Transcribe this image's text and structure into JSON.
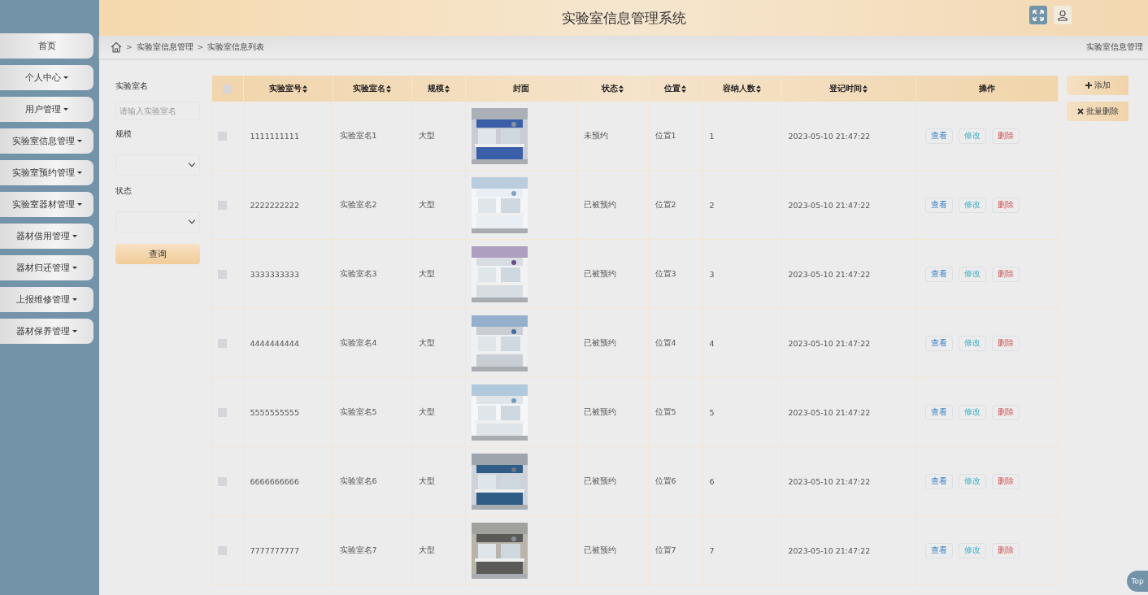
{
  "header": {
    "title": "实验室信息管理系统"
  },
  "sidebar": {
    "items": [
      {
        "label": "首页",
        "dropdown": false
      },
      {
        "label": "个人中心",
        "dropdown": true
      },
      {
        "label": "用户管理",
        "dropdown": true
      },
      {
        "label": "实验室信息管理",
        "dropdown": true
      },
      {
        "label": "实验室预约管理",
        "dropdown": true
      },
      {
        "label": "实验室器材管理",
        "dropdown": true
      },
      {
        "label": "器材借用管理",
        "dropdown": true
      },
      {
        "label": "器材归还管理",
        "dropdown": true
      },
      {
        "label": "上报维修管理",
        "dropdown": true
      },
      {
        "label": "器材保养管理",
        "dropdown": true
      }
    ]
  },
  "breadcrumb": {
    "separator": ">",
    "items": [
      "实验室信息管理",
      "实验室信息列表"
    ],
    "page_title": "实验室信息管理"
  },
  "filters": {
    "name_label": "实验室名",
    "name_placeholder": "请输入实验室名",
    "scale_label": "规模",
    "status_label": "状态",
    "query_button": "查询"
  },
  "actions": {
    "add": "添加",
    "batch_delete": "批量删除"
  },
  "table": {
    "select_all_checked": false,
    "columns": [
      {
        "label": "实验室号",
        "sortable": true
      },
      {
        "label": "实验室名",
        "sortable": true
      },
      {
        "label": "规模",
        "sortable": true
      },
      {
        "label": "封面",
        "sortable": false
      },
      {
        "label": "状态",
        "sortable": true
      },
      {
        "label": "位置",
        "sortable": true
      },
      {
        "label": "容纳人数",
        "sortable": true
      },
      {
        "label": "登记时间",
        "sortable": true
      },
      {
        "label": "操作",
        "sortable": false
      }
    ],
    "rows": [
      {
        "checked": false,
        "number": "1111111111",
        "name": "实验室名1",
        "scale": "大型",
        "status": "未预约",
        "location": "位置1",
        "capacity": "1",
        "time": "2023-05-10 21:47:22",
        "buttons": [
          "查看",
          "修改",
          "删除"
        ]
      },
      {
        "checked": false,
        "number": "2222222222",
        "name": "实验室名2",
        "scale": "大型",
        "status": "已被预约",
        "location": "位置2",
        "capacity": "2",
        "time": "2023-05-10 21:47:22",
        "buttons": [
          "查看",
          "修改",
          "删除"
        ]
      },
      {
        "checked": false,
        "number": "3333333333",
        "name": "实验室名3",
        "scale": "大型",
        "status": "已被预约",
        "location": "位置3",
        "capacity": "3",
        "time": "2023-05-10 21:47:22",
        "buttons": [
          "查看",
          "修改",
          "删除"
        ]
      },
      {
        "checked": false,
        "number": "4444444444",
        "name": "实验室名4",
        "scale": "大型",
        "status": "已被预约",
        "location": "位置4",
        "capacity": "4",
        "time": "2023-05-10 21:47:22",
        "buttons": [
          "查看",
          "修改",
          "删除"
        ]
      },
      {
        "checked": false,
        "number": "5555555555",
        "name": "实验室名5",
        "scale": "大型",
        "status": "已被预约",
        "location": "位置5",
        "capacity": "5",
        "time": "2023-05-10 21:47:22",
        "buttons": [
          "查看",
          "修改",
          "删除"
        ]
      },
      {
        "checked": false,
        "number": "6666666666",
        "name": "实验室名6",
        "scale": "大型",
        "status": "已被预约",
        "location": "位置6",
        "capacity": "6",
        "time": "2023-05-10 21:47:22",
        "buttons": [
          "查看",
          "修改",
          "删除"
        ]
      },
      {
        "checked": false,
        "number": "7777777777",
        "name": "实验室名7",
        "scale": "大型",
        "status": "已被预约",
        "location": "位置7",
        "capacity": "7",
        "time": "2023-05-10 21:47:22",
        "buttons": [
          "查看",
          "修改",
          "删除"
        ]
      }
    ]
  },
  "back_to_top": "Top"
}
